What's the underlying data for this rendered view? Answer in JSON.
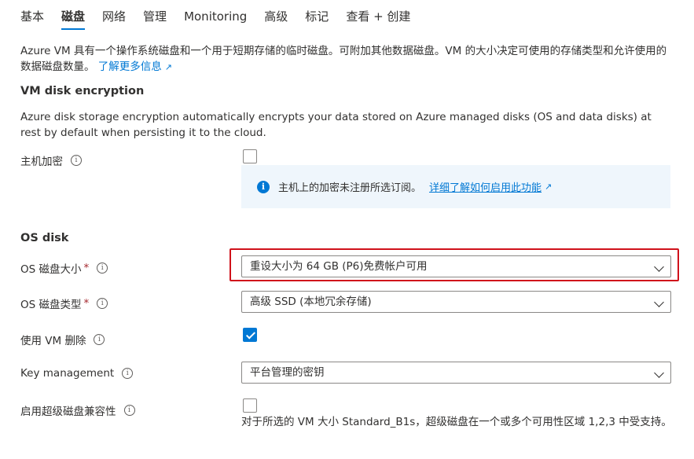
{
  "tabs": [
    {
      "label": "基本"
    },
    {
      "label": "磁盘"
    },
    {
      "label": "网络"
    },
    {
      "label": "管理"
    },
    {
      "label": "Monitoring"
    },
    {
      "label": "高级"
    },
    {
      "label": "标记"
    },
    {
      "label": "查看 + 创建"
    }
  ],
  "active_tab": "磁盘",
  "intro": {
    "text": "Azure VM 具有一个操作系统磁盘和一个用于短期存储的临时磁盘。可附加其他数据磁盘。VM 的大小决定可使用的存储类型和允许使用的数据磁盘数量。",
    "link": "了解更多信息"
  },
  "encryption": {
    "title": "VM disk encryption",
    "description": "Azure disk storage encryption automatically encrypts your data stored on Azure managed disks (OS and data disks) at rest by default when persisting it to the cloud.",
    "host_label": "主机加密",
    "host_checked": false,
    "info_message": "主机上的加密未注册所选订阅。",
    "info_link": "详细了解如何启用此功能"
  },
  "os_disk": {
    "title": "OS disk",
    "size_label": "OS 磁盘大小",
    "size_value": "重设大小为 64 GB (P6)免费帐户可用",
    "type_label": "OS 磁盘类型",
    "type_value": "高级 SSD (本地冗余存储)",
    "delete_label": "使用 VM 删除",
    "delete_checked": true,
    "key_label": "Key management",
    "key_value": "平台管理的密钥",
    "ultra_label": "启用超级磁盘兼容性",
    "ultra_checked": false,
    "ultra_note": "对于所选的 VM 大小 Standard_B1s，超级磁盘在一个或多个可用性区域 1,2,3 中受支持。"
  },
  "required_marker": "*",
  "info_glyph": "i"
}
